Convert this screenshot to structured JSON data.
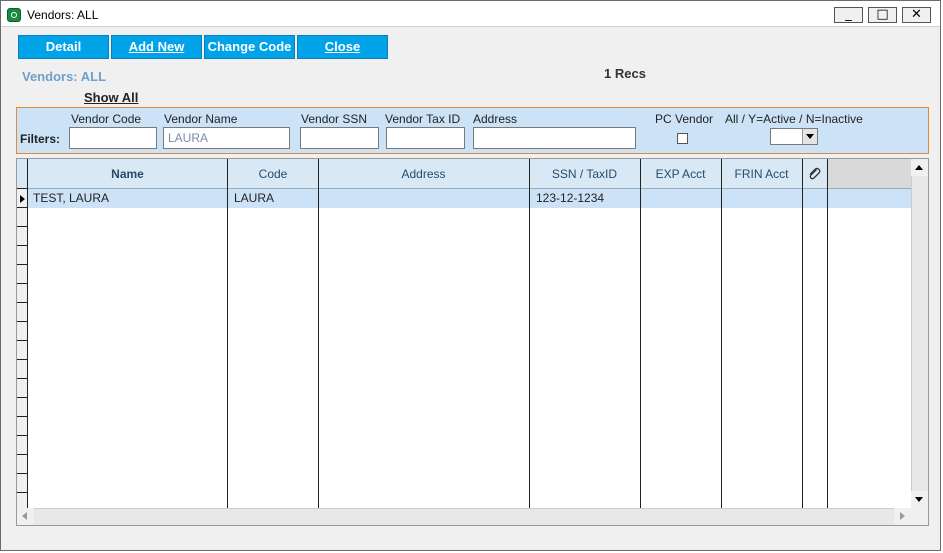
{
  "window": {
    "title": "Vendors: ALL",
    "minimize": "_",
    "maximize": "□",
    "close": "✕"
  },
  "toolbar": {
    "detail_label": "Detail",
    "add_new_label": "Add New",
    "change_code_label": "Change Code",
    "close_label": "Close"
  },
  "header": {
    "vendors_label": "Vendors: ALL",
    "recs": "1 Recs",
    "show_all": "Show All"
  },
  "filters": {
    "label": "Filters:",
    "vendor_code_label": "Vendor Code",
    "vendor_code_value": "",
    "vendor_name_label": "Vendor Name",
    "vendor_name_value": "LAURA",
    "vendor_ssn_label": "Vendor SSN",
    "vendor_ssn_value": "",
    "vendor_tax_id_label": "Vendor Tax ID",
    "vendor_tax_id_value": "",
    "address_label": "Address",
    "address_value": "",
    "pc_vendor_label": "PC Vendor",
    "status_label": "All / Y=Active / N=Inactive",
    "status_value": ""
  },
  "grid": {
    "columns": {
      "name": "Name",
      "code": "Code",
      "address": "Address",
      "ssn_taxid": "SSN / TaxID",
      "exp_acct": "EXP Acct",
      "frin_acct": "FRIN Acct"
    },
    "rows": [
      {
        "name": "TEST, LAURA",
        "code": "LAURA",
        "address": "",
        "ssn_taxid": "123-12-1234",
        "exp_acct": "",
        "frin_acct": ""
      }
    ]
  },
  "icons": {
    "attachment": "paperclip-icon",
    "app": "app-icon"
  }
}
